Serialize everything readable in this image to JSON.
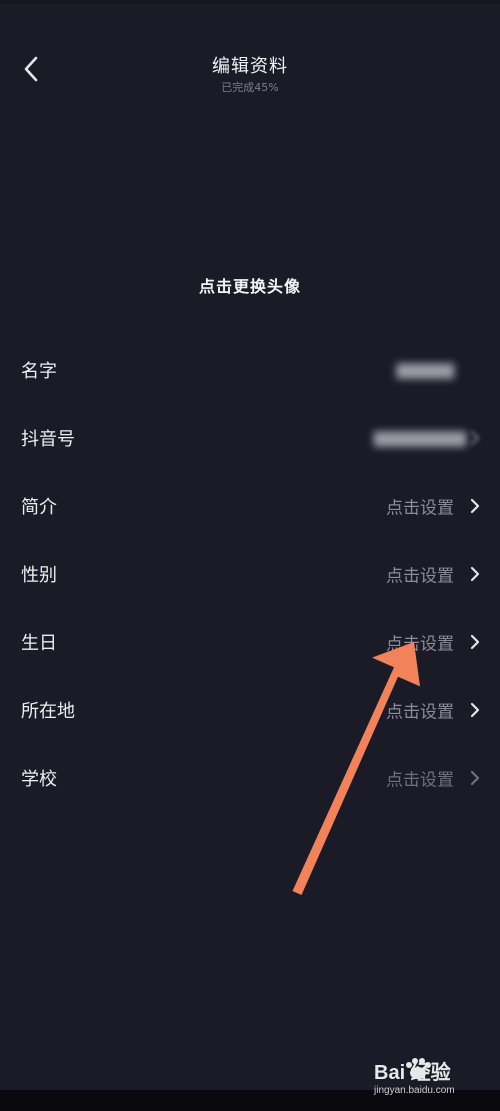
{
  "header": {
    "title": "编辑资料",
    "subtitle": "已完成45%"
  },
  "avatar": {
    "label": "点击更换头像"
  },
  "rows": [
    {
      "label": "名字",
      "value": "",
      "state": "blurred"
    },
    {
      "label": "抖音号",
      "value": "",
      "state": "blurred"
    },
    {
      "label": "简介",
      "value": "点击设置",
      "state": "normal"
    },
    {
      "label": "性别",
      "value": "点击设置",
      "state": "normal"
    },
    {
      "label": "生日",
      "value": "点击设置",
      "state": "normal"
    },
    {
      "label": "所在地",
      "value": "点击设置",
      "state": "normal"
    },
    {
      "label": "学校",
      "value": "点击设置",
      "state": "dim"
    }
  ],
  "colors": {
    "background": "#1a1b26",
    "arrow": "#f2825a"
  },
  "watermark": {
    "brand": "Bai 经验",
    "url": "jingyan.baidu.com"
  }
}
